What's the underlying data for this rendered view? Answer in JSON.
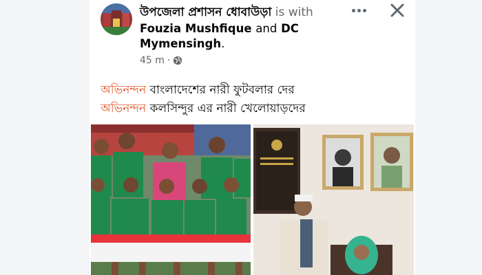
{
  "post": {
    "page_name": "উপজেলা প্রশাসন ধোবাউড়া",
    "is_with": "is with",
    "tagged_1": "Fouzia Mushfique",
    "conjunction": "and",
    "tagged_2a": "DC",
    "tagged_2b": "Mymensingh",
    "period": ".",
    "time": "45 m",
    "separator": "·",
    "privacy_icon": "globe-icon"
  },
  "body_text": {
    "line1_highlight": "অভিনন্দন",
    "line1_rest": " বাংলাদেশের নারী ফুটবলার দের",
    "line2_highlight": "অভিনন্দন",
    "line2_rest": " কলসিন্দুর এর নারী খেলোয়াড়দের"
  },
  "actions": {
    "more_icon": "more-horizontal-icon",
    "close_icon": "close-icon"
  },
  "colors": {
    "highlight": "#e4572e",
    "text": "#050505",
    "secondary": "#65676b",
    "jersey_green": "#1f8a4c",
    "jersey_red": "#e8323c"
  }
}
